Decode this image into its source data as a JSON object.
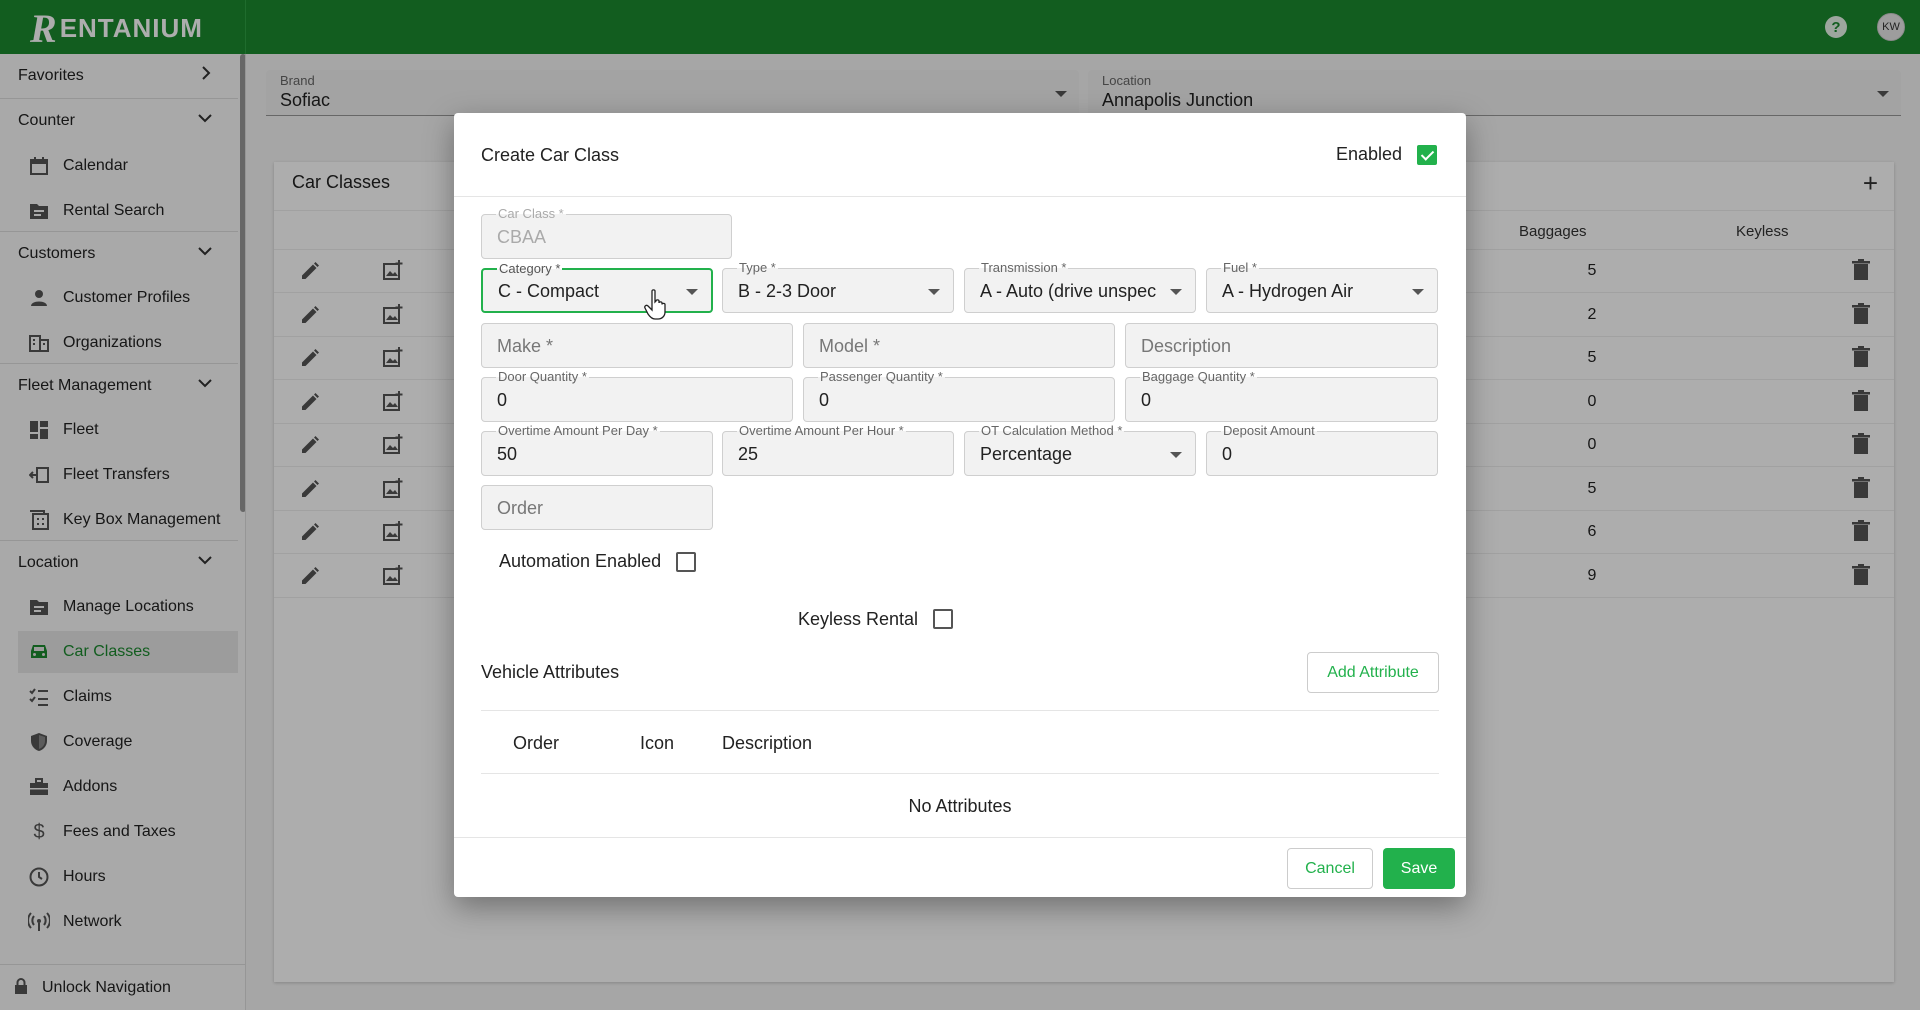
{
  "app": {
    "name": "RENTANIUM",
    "logo_letter": "R",
    "logo_rest": "ENTANIUM",
    "user_initials": "KW",
    "brand_color": "#1b8a2f",
    "accent_color": "#22b14c"
  },
  "sidebar": {
    "sections": [
      {
        "label": "Favorites",
        "icon": "chevron-right-icon"
      },
      {
        "label": "Counter",
        "icon": "chevron-down-icon"
      },
      {
        "label": "Customers",
        "icon": "chevron-down-icon"
      },
      {
        "label": "Fleet Management",
        "icon": "chevron-down-icon"
      },
      {
        "label": "Location",
        "icon": "chevron-down-icon"
      }
    ],
    "items": [
      {
        "label": "Calendar",
        "icon": "calendar-icon"
      },
      {
        "label": "Rental Search",
        "icon": "folder-icon"
      },
      {
        "label": "Customer Profiles",
        "icon": "person-icon"
      },
      {
        "label": "Organizations",
        "icon": "building-icon"
      },
      {
        "label": "Fleet",
        "icon": "dashboard-icon"
      },
      {
        "label": "Fleet Transfers",
        "icon": "transfer-icon"
      },
      {
        "label": "Key Box Management",
        "icon": "keybox-icon"
      },
      {
        "label": "Manage Locations",
        "icon": "folder-icon"
      },
      {
        "label": "Car Classes",
        "icon": "car-icon"
      },
      {
        "label": "Claims",
        "icon": "checklist-icon"
      },
      {
        "label": "Coverage",
        "icon": "shield-icon"
      },
      {
        "label": "Addons",
        "icon": "toolbox-icon"
      },
      {
        "label": "Fees and Taxes",
        "icon": "dollar-icon"
      },
      {
        "label": "Hours",
        "icon": "clock-icon"
      },
      {
        "label": "Network",
        "icon": "network-icon"
      }
    ],
    "bottom": "Unlock Navigation"
  },
  "filters": {
    "brand_label": "Brand",
    "brand_value": "Sofiac",
    "location_label": "Location",
    "location_value": "Annapolis Junction"
  },
  "card": {
    "title": "Car Classes",
    "col_baggages": "Baggages",
    "col_keyless": "Keyless",
    "baggages": [
      "5",
      "2",
      "5",
      "0",
      "0",
      "5",
      "6",
      "9"
    ]
  },
  "dialog": {
    "title": "Create Car Class",
    "enabled_label": "Enabled",
    "enabled": true,
    "car_class": {
      "label": "Car Class *",
      "value": "CBAA"
    },
    "category": {
      "label": "Category *",
      "value": "C - Compact"
    },
    "type": {
      "label": "Type *",
      "value": "B - 2-3 Door"
    },
    "transmission": {
      "label": "Transmission *",
      "value": "A - Auto (drive unspec"
    },
    "fuel": {
      "label": "Fuel *",
      "value": "A - Hydrogen Air"
    },
    "make": {
      "placeholder": "Make *"
    },
    "model": {
      "placeholder": "Model *"
    },
    "description": {
      "placeholder": "Description"
    },
    "door_qty": {
      "label": "Door Quantity *",
      "value": "0"
    },
    "passenger_qty": {
      "label": "Passenger Quantity *",
      "value": "0"
    },
    "baggage_qty": {
      "label": "Baggage Quantity *",
      "value": "0"
    },
    "ot_day": {
      "label": "Overtime Amount Per Day *",
      "value": "50"
    },
    "ot_hour": {
      "label": "Overtime Amount Per Hour *",
      "value": "25"
    },
    "ot_method": {
      "label": "OT Calculation Method *",
      "value": "Percentage"
    },
    "deposit": {
      "label": "Deposit Amount",
      "value": "0"
    },
    "order": {
      "placeholder": "Order"
    },
    "automation_label": "Automation Enabled",
    "keyless_label": "Keyless Rental",
    "attributes_title": "Vehicle Attributes",
    "add_attribute": "Add Attribute",
    "attr_cols": {
      "order": "Order",
      "icon": "Icon",
      "description": "Description"
    },
    "no_attributes": "No Attributes",
    "cancel": "Cancel",
    "save": "Save"
  }
}
